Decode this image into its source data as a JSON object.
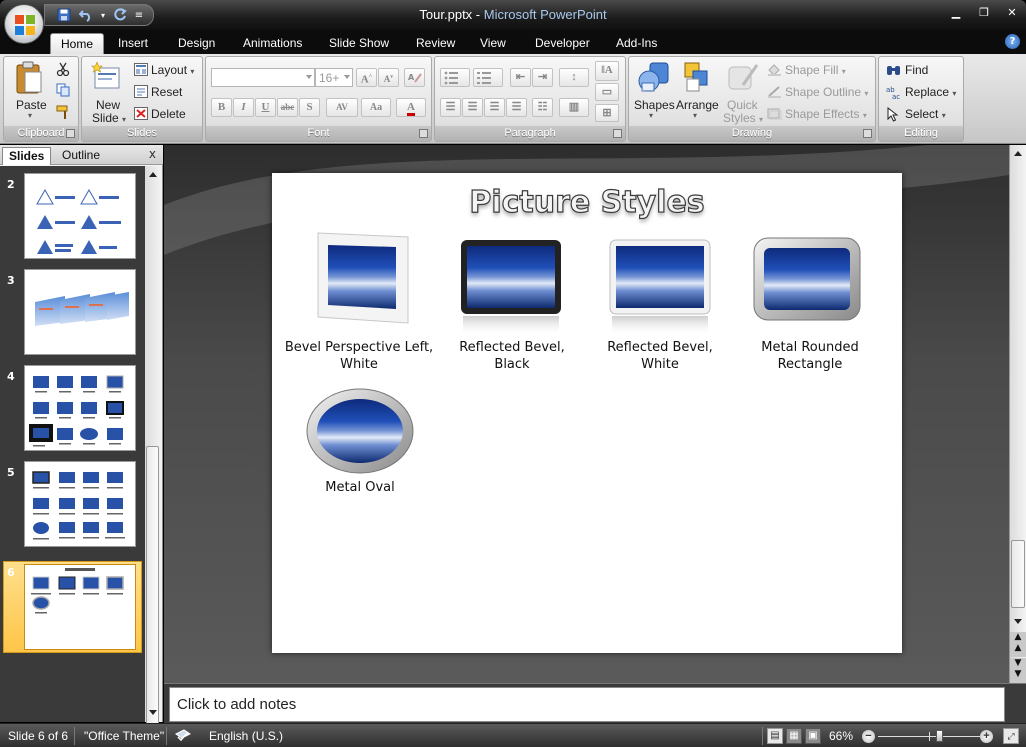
{
  "window": {
    "file": "Tour.pptx",
    "separator": " - ",
    "app": "Microsoft PowerPoint"
  },
  "tabs": [
    "Home",
    "Insert",
    "Design",
    "Animations",
    "Slide Show",
    "Review",
    "View",
    "Developer",
    "Add-Ins"
  ],
  "active_tab": "Home",
  "ribbon": {
    "clipboard": {
      "label": "Clipboard",
      "paste": "Paste"
    },
    "slides": {
      "label": "Slides",
      "new_slide_1": "New",
      "new_slide_2": "Slide",
      "layout": "Layout",
      "reset": "Reset",
      "delete": "Delete"
    },
    "font": {
      "label": "Font",
      "font_name": "",
      "font_size": "16+",
      "bold": "B",
      "italic": "I",
      "underline": "U",
      "strike": "abc",
      "shadow": "S",
      "spacing": "AV",
      "case": "Aa",
      "color": "A",
      "grow": "A",
      "shrink": "A"
    },
    "paragraph": {
      "label": "Paragraph"
    },
    "drawing": {
      "label": "Drawing",
      "shapes": "Shapes",
      "arrange": "Arrange",
      "quick_1": "Quick",
      "quick_2": "Styles",
      "shape_fill": "Shape Fill",
      "shape_outline": "Shape Outline",
      "shape_effects": "Shape Effects"
    },
    "editing": {
      "label": "Editing",
      "find": "Find",
      "replace": "Replace",
      "select": "Select"
    }
  },
  "panes": {
    "slides_tab": "Slides",
    "outline_tab": "Outline",
    "close": "x"
  },
  "thumbnails": [
    "2",
    "3",
    "4",
    "5",
    "6"
  ],
  "selected_slide": "6",
  "slide": {
    "title": "Picture Styles",
    "pictures": [
      {
        "caption_1": "Bevel Perspective Left,",
        "caption_2": "White"
      },
      {
        "caption_1": "Reflected Bevel,",
        "caption_2": "Black"
      },
      {
        "caption_1": "Reflected Bevel,",
        "caption_2": "White"
      },
      {
        "caption_1": "Metal Rounded",
        "caption_2": "Rectangle"
      },
      {
        "caption_1": "Metal Oval",
        "caption_2": ""
      }
    ]
  },
  "notes_placeholder": "Click to add notes",
  "status": {
    "slide_of": "Slide 6 of 6",
    "theme": "\"Office Theme\"",
    "language": "English (U.S.)",
    "zoom": "66%",
    "zoom_level": 0.6
  }
}
